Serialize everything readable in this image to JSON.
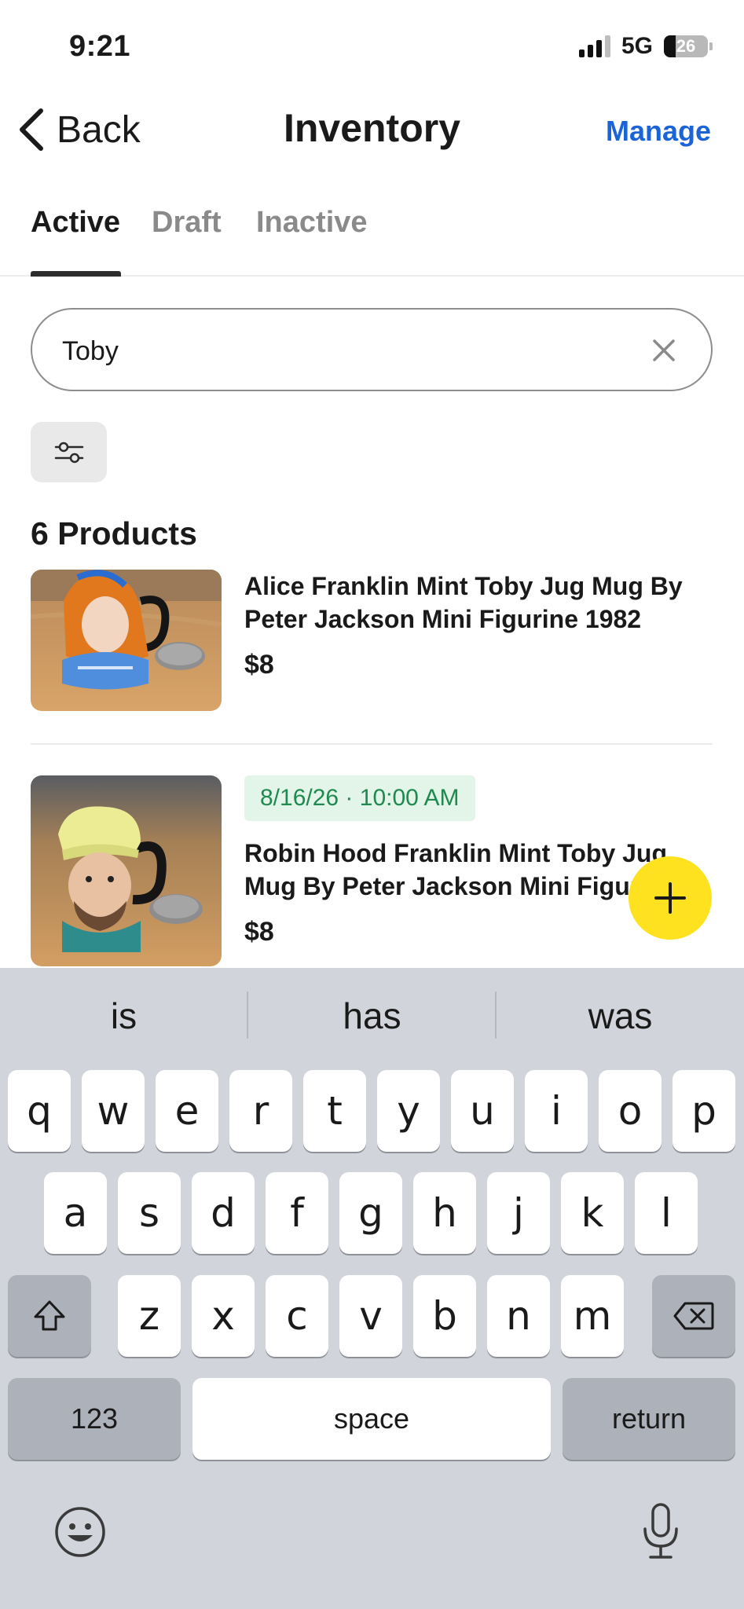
{
  "status_bar": {
    "time": "9:21",
    "network": "5G",
    "battery": "26"
  },
  "nav": {
    "back_label": "Back",
    "title": "Inventory",
    "manage_label": "Manage"
  },
  "tabs": [
    {
      "label": "Active",
      "selected": true
    },
    {
      "label": "Draft",
      "selected": false
    },
    {
      "label": "Inactive",
      "selected": false
    }
  ],
  "search": {
    "value": "Toby"
  },
  "results": {
    "count_label": "6 Products"
  },
  "products": [
    {
      "title": "Alice Franklin Mint Toby Jug Mug By Peter Jackson Mini Figurine 1982",
      "price": "$8",
      "image": "jug-figurine-girl-photo"
    },
    {
      "schedule": "8/16/26 · 10:00 AM",
      "title": "Robin Hood Franklin Mint Toby Jug Mug By Peter Jackson Mini Figurine",
      "price": "$8",
      "image": "jug-figurine-robin-hood-photo"
    }
  ],
  "fab": {
    "icon": "plus-icon",
    "color": "#ffe21f"
  },
  "keyboard": {
    "suggestions": [
      "is",
      "has",
      "was"
    ],
    "row1": [
      "q",
      "w",
      "e",
      "r",
      "t",
      "y",
      "u",
      "i",
      "o",
      "p"
    ],
    "row2": [
      "a",
      "s",
      "d",
      "f",
      "g",
      "h",
      "j",
      "k",
      "l"
    ],
    "row3": [
      "z",
      "x",
      "c",
      "v",
      "b",
      "n",
      "m"
    ],
    "numbers_label": "123",
    "space_label": "space",
    "return_label": "return"
  },
  "colors": {
    "accent": "#1b64d8",
    "schedule_bg": "#e3f4e9",
    "schedule_text": "#1f8a4f",
    "fab": "#ffe21f"
  }
}
